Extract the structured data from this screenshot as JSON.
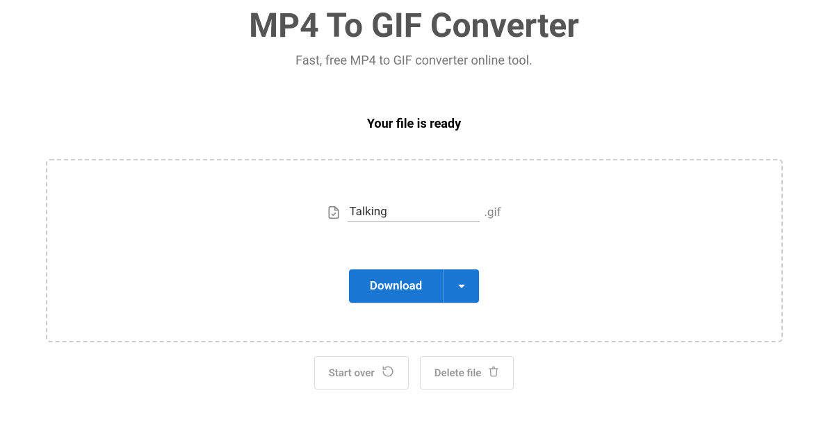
{
  "header": {
    "title": "MP4 To GIF Converter",
    "subtitle": "Fast, free MP4 to GIF converter online tool."
  },
  "status": {
    "heading": "Your file is ready"
  },
  "file": {
    "name": "Talking",
    "extension": ".gif"
  },
  "actions": {
    "download_label": "Download",
    "start_over_label": "Start over",
    "delete_file_label": "Delete file"
  }
}
